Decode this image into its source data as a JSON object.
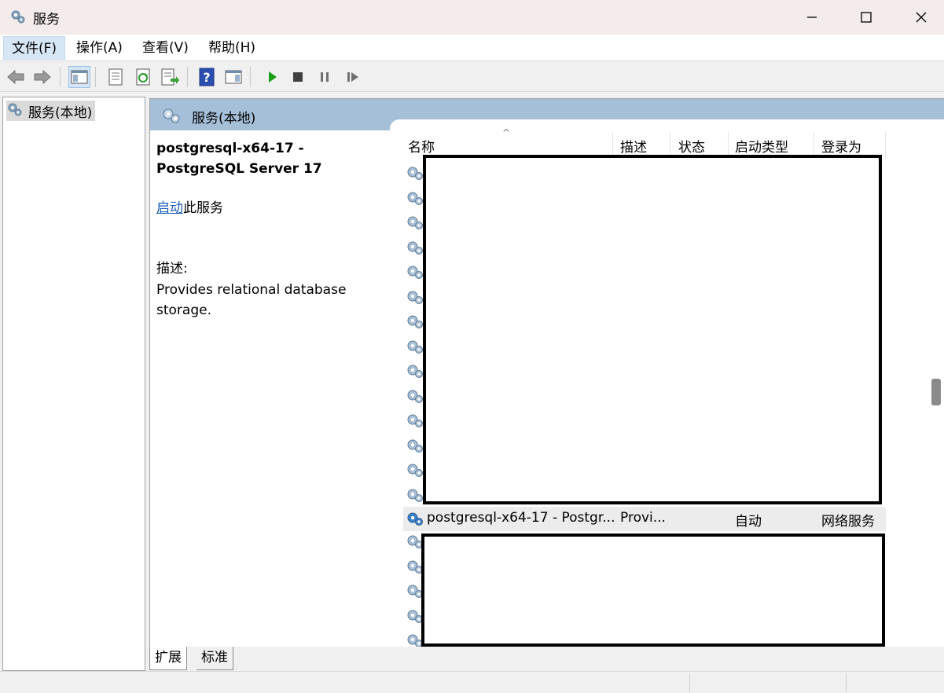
{
  "window": {
    "title": "服务"
  },
  "menu": [
    "文件(F)",
    "操作(A)",
    "查看(V)",
    "帮助(H)"
  ],
  "tree": {
    "root_label": "服务(本地)"
  },
  "right_header": {
    "title": "服务(本地)"
  },
  "detail": {
    "service_title": "postgresql-x64-17 - PostgreSQL Server 17",
    "start_link": "启动",
    "start_suffix": "此服务",
    "desc_label": "描述:",
    "desc_text": "Provides relational database storage."
  },
  "columns": [
    "名称",
    "描述",
    "状态",
    "启动类型",
    "登录为"
  ],
  "selected_row": {
    "name": "postgresql-x64-17 - Postgr...",
    "description": "Provi...",
    "status": "",
    "startup": "自动",
    "logon": "网络服务"
  },
  "tabs": [
    "扩展",
    "标准"
  ],
  "colors": {
    "header_bg": "#a5bfd8",
    "link": "#1a5fb4",
    "play": "#1a9e1a"
  }
}
